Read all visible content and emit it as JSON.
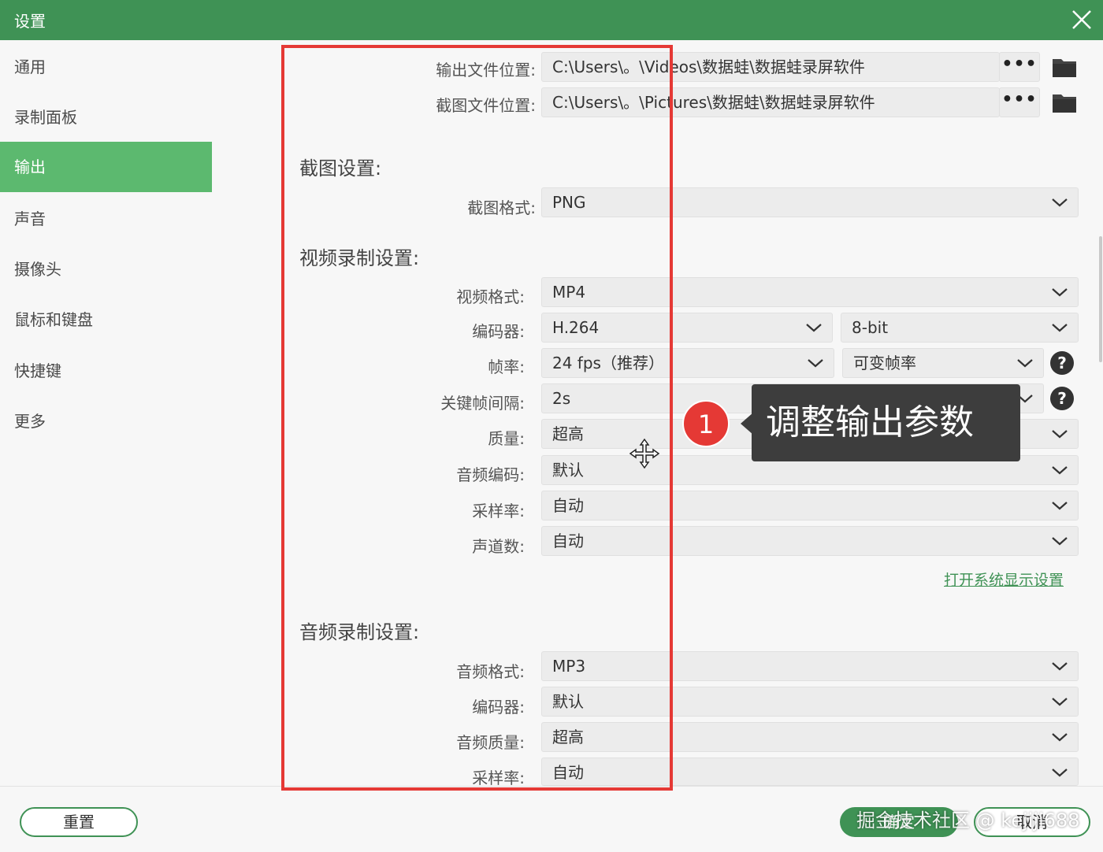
{
  "window": {
    "title": "设置"
  },
  "sidebar": {
    "items": [
      {
        "label": "通用"
      },
      {
        "label": "录制面板"
      },
      {
        "label": "输出",
        "active": true
      },
      {
        "label": "声音"
      },
      {
        "label": "摄像头"
      },
      {
        "label": "鼠标和键盘"
      },
      {
        "label": "快捷键"
      },
      {
        "label": "更多"
      }
    ]
  },
  "output": {
    "video_path_label": "输出文件位置:",
    "video_path_value": "C:\\Users\\。\\Videos\\数据蛙\\数据蛙录屏软件",
    "screenshot_path_label": "截图文件位置:",
    "screenshot_path_value": "C:\\Users\\。\\Pictures\\数据蛙\\数据蛙录屏软件",
    "browse_label": "•••"
  },
  "screenshot_settings": {
    "title": "截图设置:",
    "format_label": "截图格式:",
    "format_value": "PNG"
  },
  "video_settings": {
    "title": "视频录制设置:",
    "format_label": "视频格式:",
    "format_value": "MP4",
    "encoder_label": "编码器:",
    "encoder_value": "H.264",
    "bitdepth_value": "8-bit",
    "framerate_label": "帧率:",
    "framerate_value": "24 fps（推荐）",
    "framerate_mode_value": "可变帧率",
    "keyframe_label": "关键帧间隔:",
    "keyframe_value": "2s",
    "quality_label": "质量:",
    "quality_value": "超高",
    "audio_codec_label": "音频编码:",
    "audio_codec_value": "默认",
    "sample_rate_label": "采样率:",
    "sample_rate_value": "自动",
    "channels_label": "声道数:",
    "channels_value": "自动",
    "display_link": "打开系统显示设置"
  },
  "audio_settings": {
    "title": "音频录制设置:",
    "format_label": "音频格式:",
    "format_value": "MP3",
    "encoder_label": "编码器:",
    "encoder_value": "默认",
    "quality_label": "音频质量:",
    "quality_value": "超高",
    "sample_rate_label": "采样率:",
    "sample_rate_value": "自动"
  },
  "annotation": {
    "step_number": "1",
    "callout_text": "调整输出参数"
  },
  "footer": {
    "reset_label": "重置",
    "ok_label": "确定",
    "cancel_label": "取消",
    "watermark": "掘金技术社区 @ kejiji688"
  },
  "colors": {
    "brand_green": "#3f9255",
    "active_green": "#5cb96f",
    "highlight_red": "#e53935"
  },
  "icons": [
    "close-icon",
    "folder-icon",
    "chevron-down-icon",
    "help-icon",
    "move-cursor-icon"
  ]
}
